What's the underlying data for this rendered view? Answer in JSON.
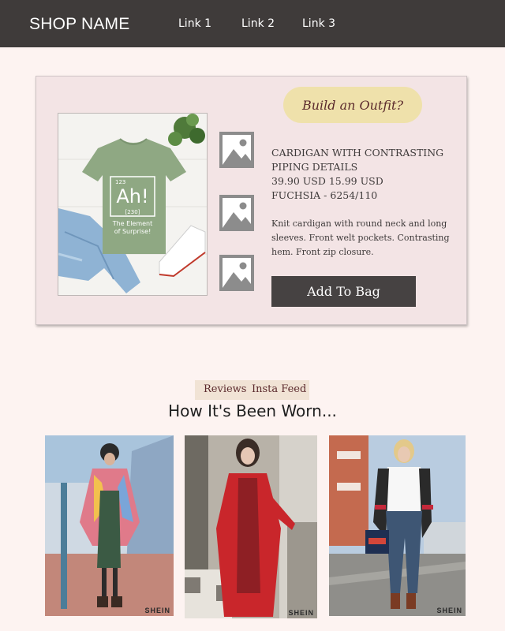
{
  "header": {
    "shop_name": "SHOP NAME",
    "links": [
      "Link 1",
      "Link 2",
      "Link 3"
    ]
  },
  "product": {
    "build_outfit_label": "Build an Outfit?",
    "title_line_1": "CARDIGAN WITH CONTRASTING",
    "title_line_2": "PIPING DETAILS",
    "price_line": "39.90 USD 15.99 USD",
    "color_line": "FUCHSIA - 6254/110",
    "description": "Knit cardigan with round neck and long sleeves. Front welt pockets. Contrasting hem. Front zip closure.",
    "add_to_bag_label": "Add To Bag",
    "tshirt_print": {
      "atomic_number": "123",
      "symbol": "Ah!",
      "mass": "[230]",
      "caption_line_1": "The Element",
      "caption_line_2": "of Surprise!"
    },
    "thumbnail_icons": [
      "image-placeholder-icon",
      "image-placeholder-icon",
      "image-placeholder-icon"
    ]
  },
  "social": {
    "tabs": [
      "Reviews",
      "Insta Feed"
    ],
    "section_title": "How It's Been Worn...",
    "brand_watermark": "SHEIN"
  },
  "colors": {
    "nav_bg": "#3f3b3a",
    "page_bg": "#fdf3f1",
    "card_bg": "#f3e4e5",
    "outfit_button": "#efe1ab",
    "bag_button": "#464242",
    "tshirt": "#8fa883"
  }
}
